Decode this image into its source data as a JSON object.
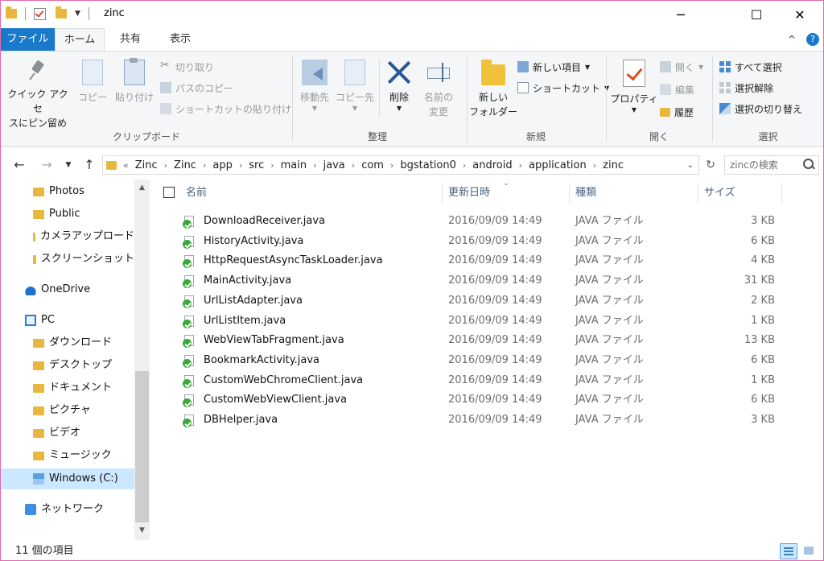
{
  "window": {
    "title": "zinc",
    "minimize": "─",
    "maximize": "☐",
    "close": "✕"
  },
  "tabs": {
    "file": "ファイル",
    "home": "ホーム",
    "share": "共有",
    "view": "表示",
    "collapse": "^",
    "help": "?"
  },
  "ribbon": {
    "clipboard": {
      "label": "クリップボード",
      "pin_line1": "クイック アクセ",
      "pin_line2": "スにピン留め",
      "copy": "コピー",
      "paste": "貼り付け",
      "cut": "切り取り",
      "copy_path": "パスのコピー",
      "paste_shortcut": "ショートカットの貼り付け"
    },
    "organize": {
      "label": "整理",
      "move_to": "移動先",
      "copy_to": "コピー先",
      "delete": "削除",
      "rename_line1": "名前の",
      "rename_line2": "変更"
    },
    "new": {
      "label": "新規",
      "new_folder_line1": "新しい",
      "new_folder_line2": "フォルダー",
      "new_item": "新しい項目",
      "shortcut": "ショートカット"
    },
    "open": {
      "label": "開く",
      "properties": "プロパティ",
      "open": "開く",
      "edit": "編集",
      "history": "履歴"
    },
    "select": {
      "label": "選択",
      "select_all": "すべて選択",
      "select_none": "選択解除",
      "invert": "選択の切り替え"
    }
  },
  "address": {
    "crumbs": [
      "Zinc",
      "Zinc",
      "app",
      "src",
      "main",
      "java",
      "com",
      "bgstation0",
      "android",
      "application",
      "zinc"
    ],
    "overflow": "«",
    "search_placeholder": "zincの検索"
  },
  "nav": {
    "items": [
      {
        "label": "Photos",
        "icon": "folder-icon"
      },
      {
        "label": "Public",
        "icon": "folder-icon"
      },
      {
        "label": "カメラアップロード",
        "icon": "folder-icon"
      },
      {
        "label": "スクリーンショット",
        "icon": "folder-icon"
      },
      {
        "label": "OneDrive",
        "icon": "cloud-icon"
      },
      {
        "label": "PC",
        "icon": "pc-icon"
      },
      {
        "label": "ダウンロード",
        "icon": "download-icon"
      },
      {
        "label": "デスクトップ",
        "icon": "desktop-icon"
      },
      {
        "label": "ドキュメント",
        "icon": "documents-icon"
      },
      {
        "label": "ピクチャ",
        "icon": "pictures-icon"
      },
      {
        "label": "ビデオ",
        "icon": "video-icon"
      },
      {
        "label": "ミュージック",
        "icon": "music-icon"
      },
      {
        "label": "Windows (C:)",
        "icon": "drive-icon"
      },
      {
        "label": "ネットワーク",
        "icon": "network-icon"
      }
    ]
  },
  "columns": {
    "name": "名前",
    "date": "更新日時",
    "type": "種類",
    "size": "サイズ"
  },
  "files": [
    {
      "name": "DownloadReceiver.java",
      "date": "2016/09/09 14:49",
      "type": "JAVA ファイル",
      "size": "3 KB"
    },
    {
      "name": "HistoryActivity.java",
      "date": "2016/09/09 14:49",
      "type": "JAVA ファイル",
      "size": "6 KB"
    },
    {
      "name": "HttpRequestAsyncTaskLoader.java",
      "date": "2016/09/09 14:49",
      "type": "JAVA ファイル",
      "size": "4 KB"
    },
    {
      "name": "MainActivity.java",
      "date": "2016/09/09 14:49",
      "type": "JAVA ファイル",
      "size": "31 KB"
    },
    {
      "name": "UrlListAdapter.java",
      "date": "2016/09/09 14:49",
      "type": "JAVA ファイル",
      "size": "2 KB"
    },
    {
      "name": "UrlListItem.java",
      "date": "2016/09/09 14:49",
      "type": "JAVA ファイル",
      "size": "1 KB"
    },
    {
      "name": "WebViewTabFragment.java",
      "date": "2016/09/09 14:49",
      "type": "JAVA ファイル",
      "size": "13 KB"
    },
    {
      "name": "BookmarkActivity.java",
      "date": "2016/09/09 14:49",
      "type": "JAVA ファイル",
      "size": "6 KB"
    },
    {
      "name": "CustomWebChromeClient.java",
      "date": "2016/09/09 14:49",
      "type": "JAVA ファイル",
      "size": "1 KB"
    },
    {
      "name": "CustomWebViewClient.java",
      "date": "2016/09/09 14:49",
      "type": "JAVA ファイル",
      "size": "6 KB"
    },
    {
      "name": "DBHelper.java",
      "date": "2016/09/09 14:49",
      "type": "JAVA ファイル",
      "size": "3 KB"
    }
  ],
  "status": {
    "count": "11 個の項目"
  },
  "colors": {
    "accent": "#1979ca",
    "selection": "#cce8ff",
    "border": "#e06ab0"
  }
}
